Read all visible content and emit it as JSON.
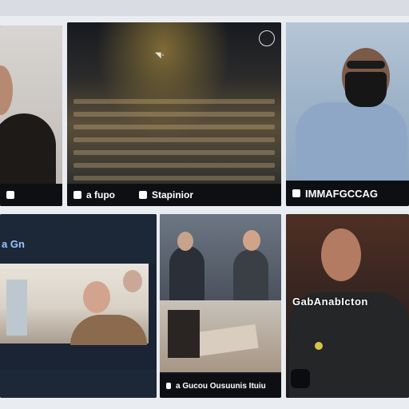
{
  "grid": {
    "tiles": [
      {
        "caption": ""
      },
      {
        "caption_left": "a fupo",
        "caption_right": "Stapinior"
      },
      {
        "caption": "IMMAFGCCAG"
      },
      {
        "label": "a Gn"
      },
      {
        "caption": "a Gucou Ousuunis Ituiu"
      },
      {
        "overlay": "GabAnabIcton"
      }
    ]
  }
}
